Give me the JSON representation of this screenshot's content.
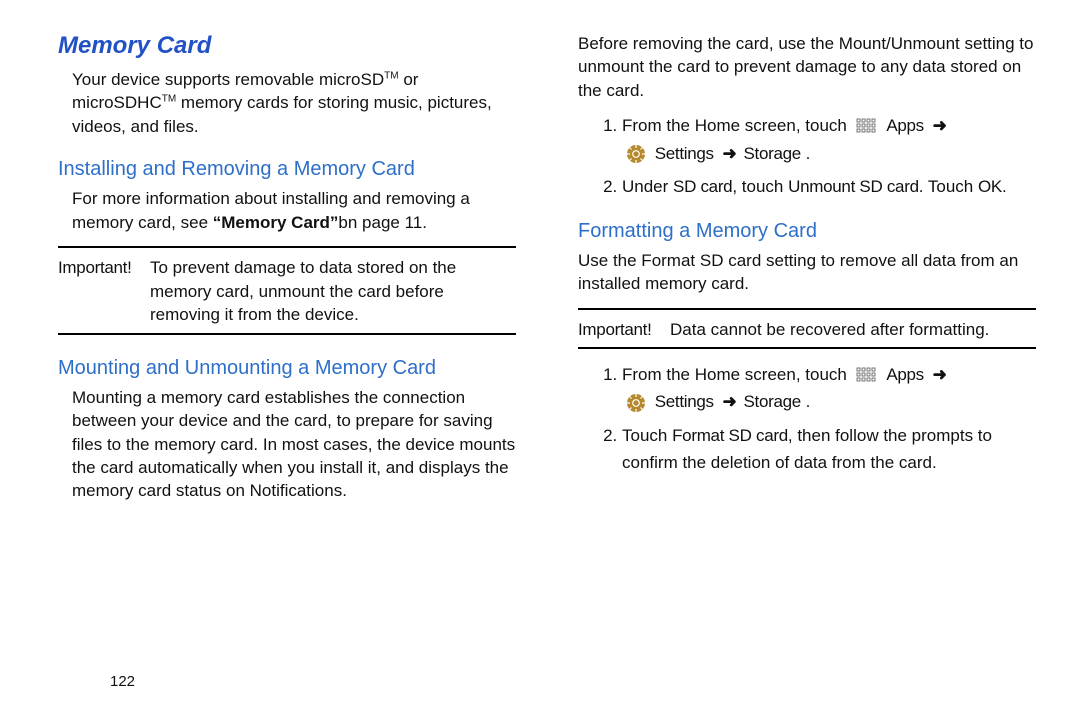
{
  "left": {
    "title": "Memory Card",
    "intro_a": "Your device supports removable microSD",
    "intro_b": " or microSDHC",
    "intro_c": " memory cards for storing music, pictures, videos, and files.",
    "sec1": {
      "heading": "Installing and Removing a Memory Card",
      "p1_a": "For more information about installing and removing a memory card, see ",
      "p1_bold": "“Memory Card”",
      "p1_b": "bn page 11."
    },
    "important_label": "Important!",
    "important_text": "To prevent damage to data stored on the memory card, unmount the card before removing it from the device.",
    "sec2": {
      "heading": "Mounting and Unmounting a Memory Card",
      "p1": "Mounting a memory card establishes the connection between your device and the card, to prepare for saving files to the memory card. In most cases, the device mounts the card automatically when you install it, and displays the memory card status on Notifications."
    }
  },
  "right": {
    "intro": "Before removing the card, use the Mount/Unmount setting to unmount the card to prevent damage to any data stored on the card.",
    "step1_a": "From the Home screen, touch ",
    "apps_label": "Apps",
    "settings_label": "Settings",
    "storage_label": "Storage",
    "step2_a": "Under ",
    "sd_card": "SD card",
    "step2_b": ", touch ",
    "unmount_sd": "Unmount SD card",
    "step2_c": ". Touch ",
    "ok": "OK",
    "period": ".",
    "sec3": {
      "heading": "Formatting a Memory Card",
      "p1": "Use the Format SD card setting to remove all data from an installed memory card."
    },
    "important_label": "Important!",
    "important_text": "Data cannot be recovered after formatting.",
    "format_step2_a": "Touch ",
    "format_sd": "Format SD card",
    "format_step2_b": ", then follow the prompts to confirm the deletion of data from the card."
  },
  "page_number": "122"
}
